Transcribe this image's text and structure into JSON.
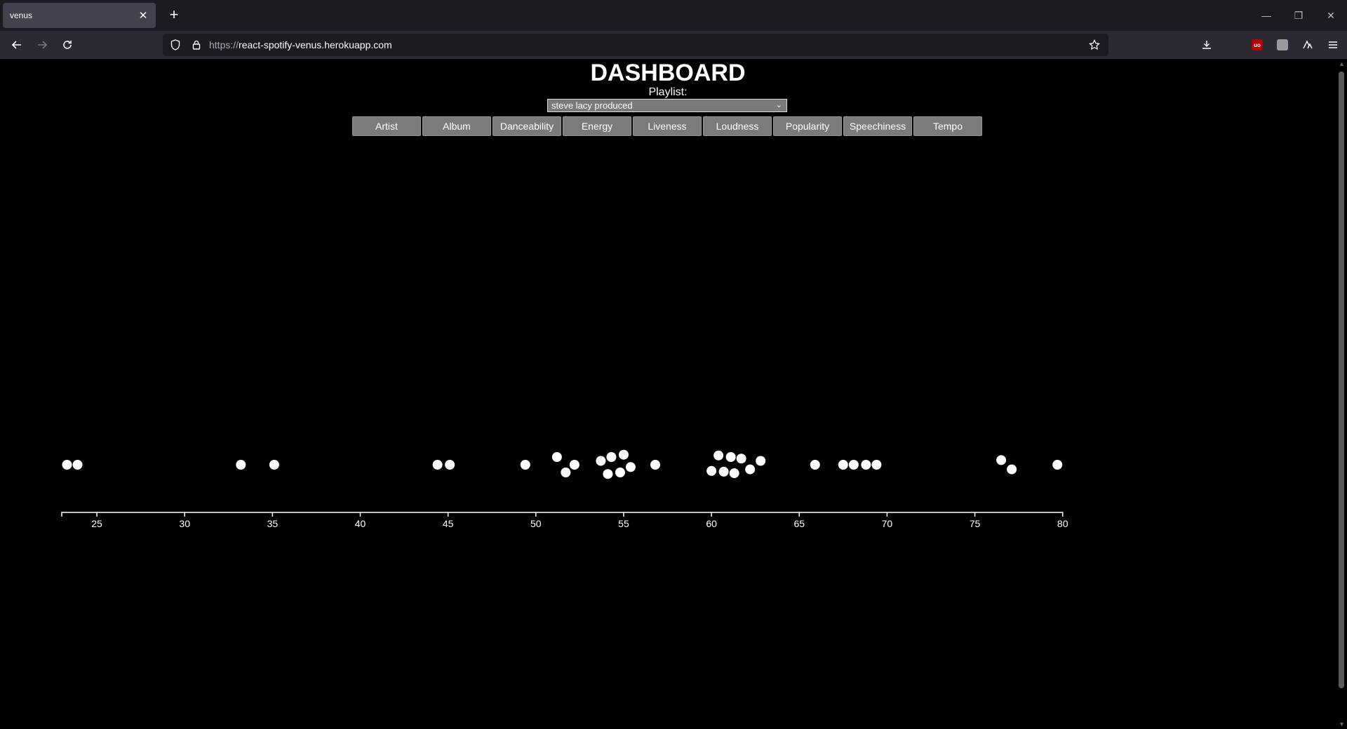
{
  "browser": {
    "tab_title": "venus",
    "url_scheme": "https://",
    "url_host": "react-spotify-venus.herokuapp.com"
  },
  "page": {
    "title": "DASHBOARD",
    "playlist_label": "Playlist:",
    "playlist_selected": "steve lacy produced",
    "metric_buttons": [
      "Artist",
      "Album",
      "Danceability",
      "Energy",
      "Liveness",
      "Loudness",
      "Popularity",
      "Speechiness",
      "Tempo"
    ]
  },
  "colors": {
    "background": "#000000",
    "point": "#ffffff",
    "button": "#7b7b7b"
  },
  "chart_data": {
    "type": "scatter",
    "title": "",
    "xlabel": "",
    "ylabel": "",
    "xlim": [
      23,
      80
    ],
    "xticks": [
      25,
      30,
      35,
      40,
      45,
      50,
      55,
      60,
      65,
      70,
      75,
      80
    ],
    "grid": false,
    "points": [
      {
        "x": 23.3,
        "row": 0
      },
      {
        "x": 23.9,
        "row": 0
      },
      {
        "x": 33.2,
        "row": 0
      },
      {
        "x": 35.1,
        "row": 0
      },
      {
        "x": 44.4,
        "row": 0
      },
      {
        "x": 45.1,
        "row": 0
      },
      {
        "x": 49.4,
        "row": 0
      },
      {
        "x": 51.2,
        "row": -1
      },
      {
        "x": 51.7,
        "row": 1
      },
      {
        "x": 52.2,
        "row": 0
      },
      {
        "x": 53.7,
        "row": -0.5
      },
      {
        "x": 54.1,
        "row": 1.2
      },
      {
        "x": 54.3,
        "row": -1
      },
      {
        "x": 54.8,
        "row": 1
      },
      {
        "x": 55.0,
        "row": -1.3
      },
      {
        "x": 55.4,
        "row": 0.3
      },
      {
        "x": 56.8,
        "row": 0
      },
      {
        "x": 60.0,
        "row": 0.8
      },
      {
        "x": 60.4,
        "row": -1.2
      },
      {
        "x": 60.7,
        "row": 0.9
      },
      {
        "x": 61.1,
        "row": -1
      },
      {
        "x": 61.3,
        "row": 1.1
      },
      {
        "x": 61.7,
        "row": -0.8
      },
      {
        "x": 62.2,
        "row": 0.6
      },
      {
        "x": 62.8,
        "row": -0.5
      },
      {
        "x": 65.9,
        "row": 0
      },
      {
        "x": 67.5,
        "row": 0
      },
      {
        "x": 68.1,
        "row": 0
      },
      {
        "x": 68.8,
        "row": 0
      },
      {
        "x": 69.4,
        "row": 0
      },
      {
        "x": 76.5,
        "row": -0.6
      },
      {
        "x": 77.1,
        "row": 0.6
      },
      {
        "x": 79.7,
        "row": 0
      }
    ]
  }
}
